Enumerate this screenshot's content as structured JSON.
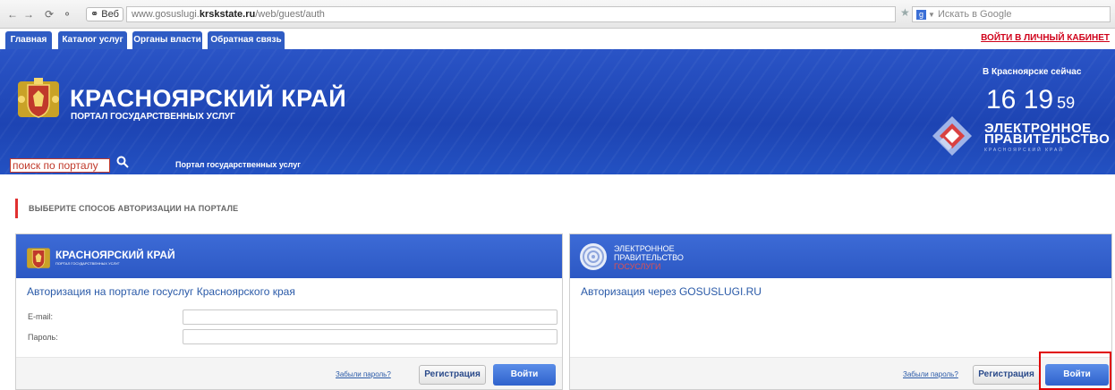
{
  "browser": {
    "web_button": "Веб",
    "url_prefix": "www.gosuslugi.",
    "url_domain": "krskstate.ru",
    "url_path": "/web/guest/auth",
    "search_placeholder": "Искать в Google"
  },
  "topnav": {
    "tabs": [
      "Главная",
      "Каталог услуг",
      "Органы власти",
      "Обратная связь"
    ],
    "cabinet_link": "ВОЙТИ В ЛИЧНЫЙ КАБИНЕТ"
  },
  "header": {
    "title": "КРАСНОЯРСКИЙ КРАЙ",
    "subtitle": "ПОРТАЛ ГОСУДАРСТВЕННЫХ УСЛУГ",
    "now_label": "В Красноярске сейчас",
    "clock_hours": "16",
    "clock_minutes": "19",
    "clock_seconds": "59",
    "egov_line1": "ЭЛЕКТРОННОЕ",
    "egov_line2": "ПРАВИТЕЛЬСТВО",
    "egov_region": "КРАСНОЯРСКИЙ КРАЙ",
    "search_placeholder": "поиск по порталу",
    "portal_link": "Портал государственных услуг"
  },
  "auth": {
    "heading": "ВЫБЕРИТЕ СПОСОБ АВТОРИЗАЦИИ НА ПОРТАЛЕ",
    "left_panel": {
      "logo_title": "КРАСНОЯРСКИЙ КРАЙ",
      "logo_subtitle": "ПОРТАЛ ГОСУДАРСТВЕННЫХ УСЛУГ",
      "title": "Авторизация на портале госуслуг Красноярского края",
      "email_label": "E-mail:",
      "password_label": "Пароль:",
      "forgot_link": "Забыли пароль?",
      "register_button": "Регистрация",
      "login_button": "Войти"
    },
    "right_panel": {
      "logo_line1": "ЭЛЕКТРОННОЕ",
      "logo_line2": "ПРАВИТЕЛЬСТВО",
      "logo_line3": "ГОСУСЛУГИ",
      "title": "Авторизация через GOSUSLUGI.RU",
      "forgot_link": "Забыли пароль?",
      "register_button": "Регистрация",
      "login_button": "Войти"
    }
  },
  "colors": {
    "brand_blue": "#2a54c6",
    "accent_red": "#d0021b",
    "highlight": "#e00000"
  }
}
